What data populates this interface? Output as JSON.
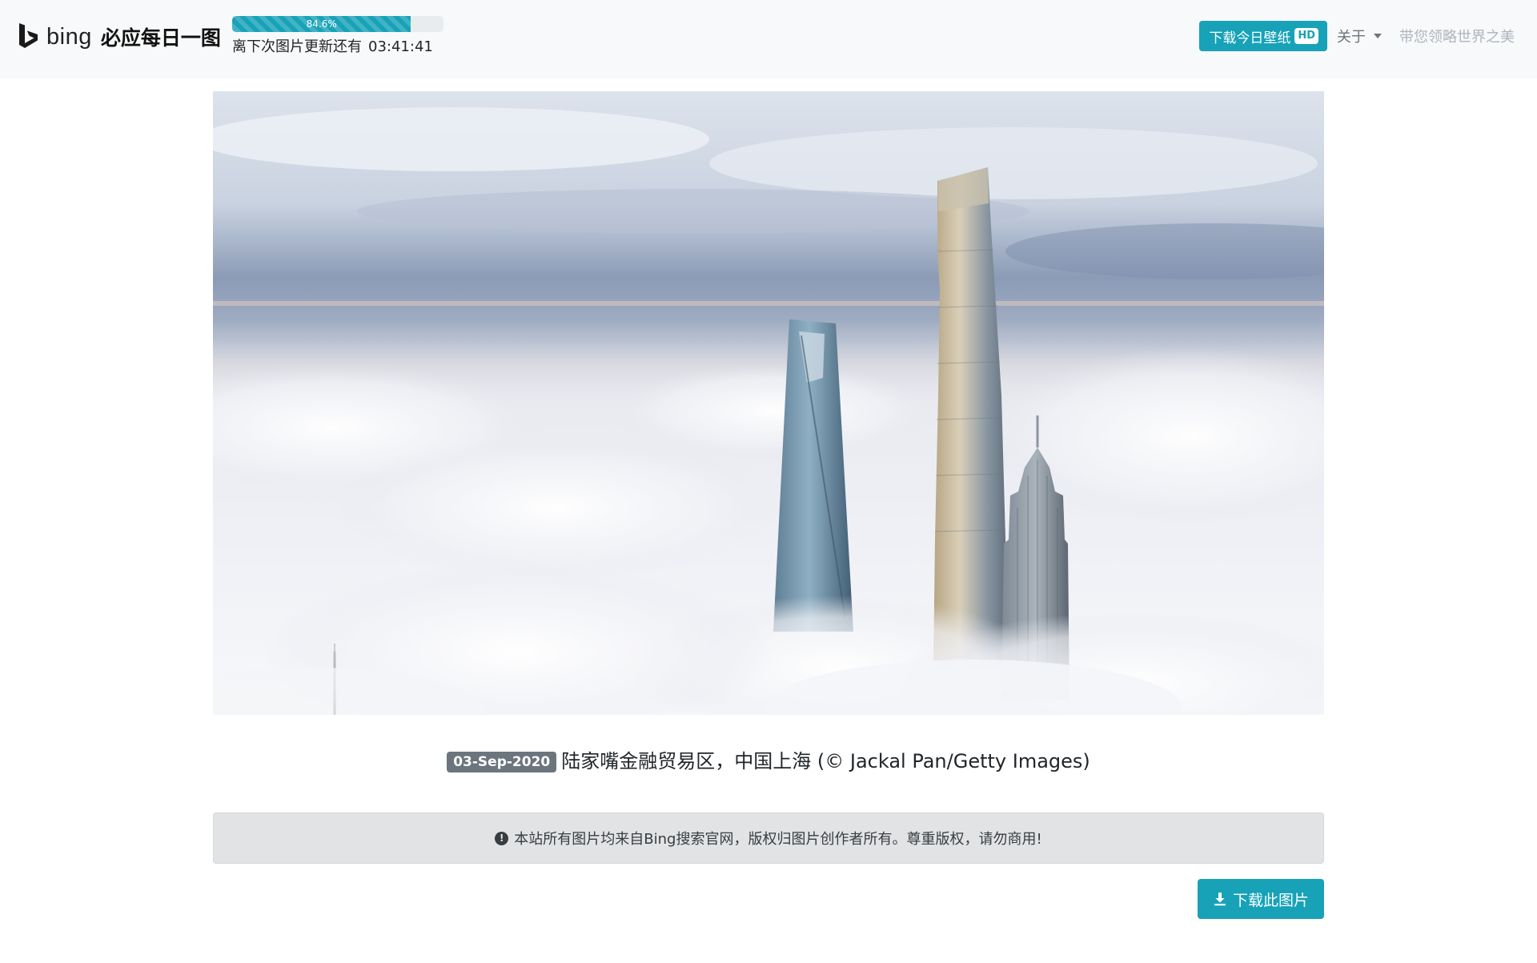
{
  "brand": {
    "logo_icon": "bing-logo-icon",
    "wordmark": "bing",
    "title": "必应每日一图"
  },
  "countdown": {
    "progress_percent": 84.6,
    "progress_label": "84.6%",
    "label": "离下次图片更新还有",
    "time_left": "03:41:41"
  },
  "nav": {
    "download_today_label": "下载今日壁纸",
    "hd_badge": "HD",
    "about_label": "关于",
    "slogan": "带您领略世界之美"
  },
  "photo": {
    "subject": "Shanghai Lujiazui skyscrapers above a sea of clouds"
  },
  "caption": {
    "date": "03-Sep-2020",
    "text": "陆家嘴金融贸易区，中国上海 (© Jackal Pan/Getty Images)"
  },
  "notice": {
    "icon": "exclamation-circle-icon",
    "text": "本站所有图片均来自Bing搜索官网，版权归图片创作者所有。尊重版权，请勿商用!"
  },
  "download": {
    "icon": "download-icon",
    "label": "下载此图片"
  },
  "colors": {
    "accent": "#17a2b8",
    "badge": "#6c757d",
    "notice_bg": "#e2e3e5",
    "navbar_bg": "#f8f9fa"
  }
}
